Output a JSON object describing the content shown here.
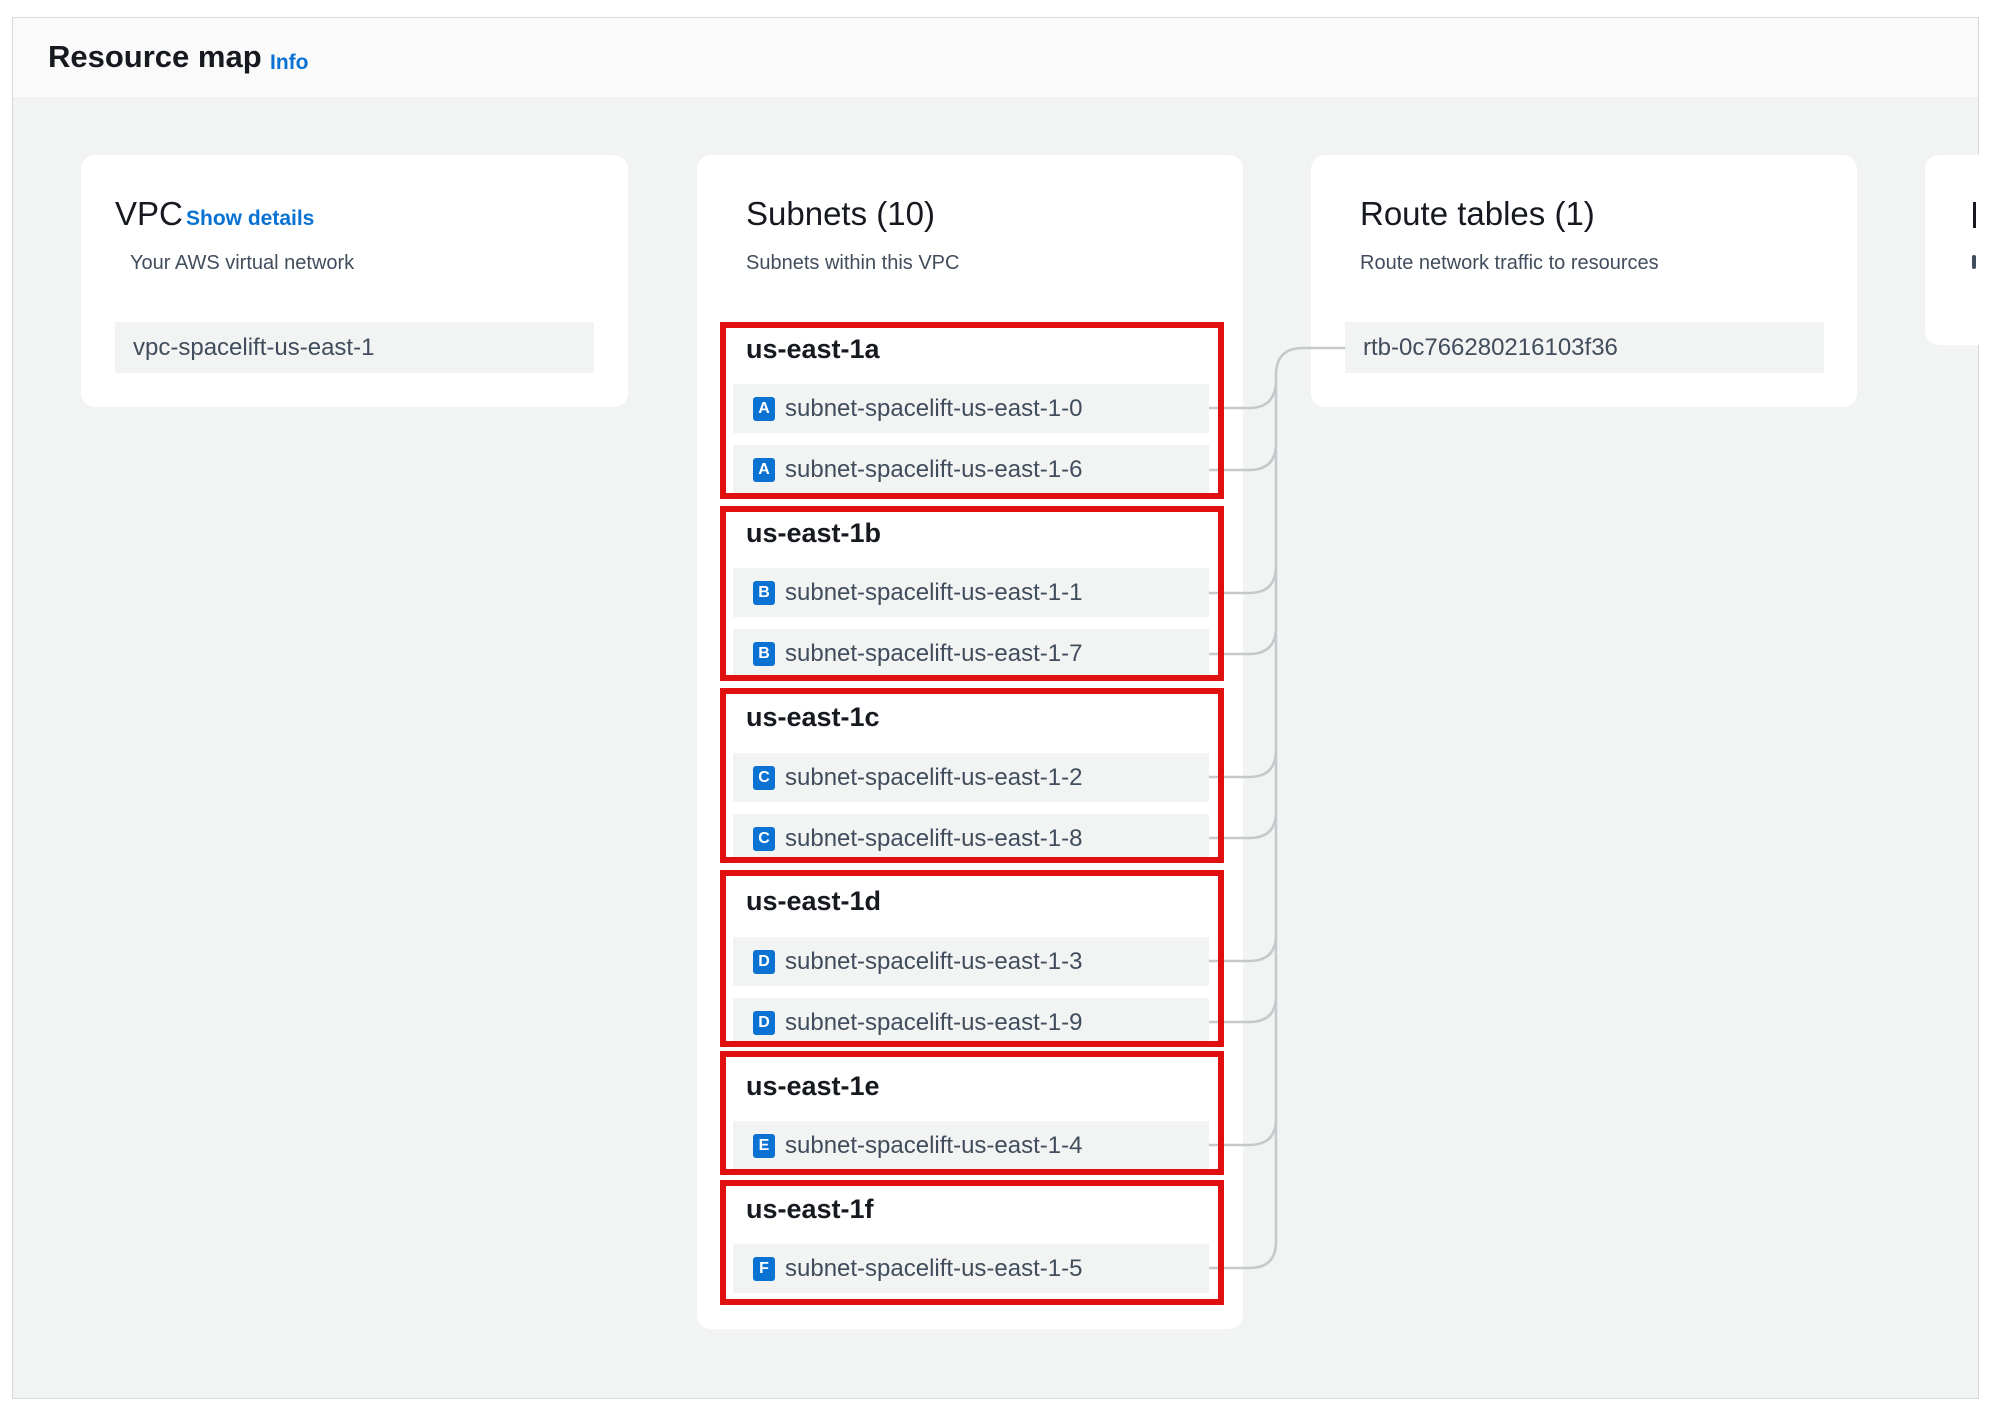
{
  "header": {
    "title": "Resource map",
    "info_link": "Info"
  },
  "vpc": {
    "title": "VPC",
    "show_details": "Show details",
    "description": "Your AWS virtual network",
    "item": "vpc-spacelift-us-east-1"
  },
  "subnets": {
    "title": "Subnets (10)",
    "description": "Subnets within this VPC",
    "groups": [
      {
        "zone": "us-east-1a",
        "badge": "A",
        "items": [
          "subnet-spacelift-us-east-1-0",
          "subnet-spacelift-us-east-1-6"
        ]
      },
      {
        "zone": "us-east-1b",
        "badge": "B",
        "items": [
          "subnet-spacelift-us-east-1-1",
          "subnet-spacelift-us-east-1-7"
        ]
      },
      {
        "zone": "us-east-1c",
        "badge": "C",
        "items": [
          "subnet-spacelift-us-east-1-2",
          "subnet-spacelift-us-east-1-8"
        ]
      },
      {
        "zone": "us-east-1d",
        "badge": "D",
        "items": [
          "subnet-spacelift-us-east-1-3",
          "subnet-spacelift-us-east-1-9"
        ]
      },
      {
        "zone": "us-east-1e",
        "badge": "E",
        "items": [
          "subnet-spacelift-us-east-1-4"
        ]
      },
      {
        "zone": "us-east-1f",
        "badge": "F",
        "items": [
          "subnet-spacelift-us-east-1-5"
        ]
      }
    ]
  },
  "route_tables": {
    "title": "Route tables (1)",
    "description": "Route network traffic to resources",
    "item": "rtb-0c766280216103f36"
  },
  "colors": {
    "link": "#0972d3",
    "highlight_border": "#e00f10",
    "badge": "#0972d3",
    "panel_bg": "#f2f3f3"
  }
}
